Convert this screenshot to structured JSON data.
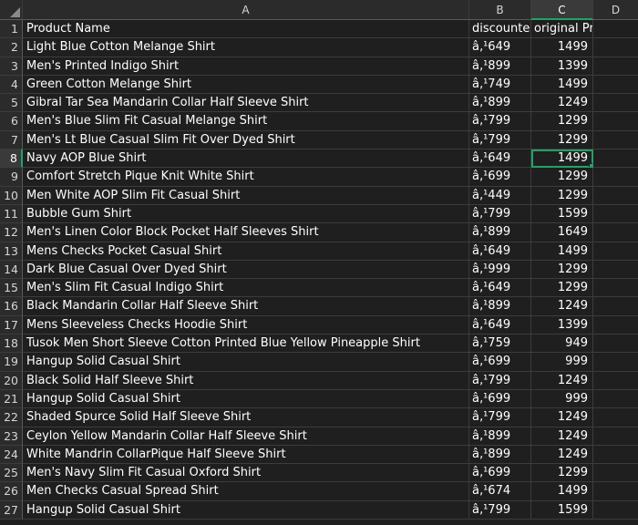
{
  "columns": [
    "A",
    "B",
    "C",
    "D"
  ],
  "header_row": {
    "product": "Product Name",
    "discounted": "discounte",
    "original": "original Price"
  },
  "rows": [
    {
      "n": "2",
      "product": "Light Blue Cotton Melange Shirt",
      "discounted": "â‚¹649",
      "original": "1499"
    },
    {
      "n": "3",
      "product": "Men's Printed Indigo Shirt",
      "discounted": "â‚¹899",
      "original": "1399"
    },
    {
      "n": "4",
      "product": "Green Cotton Melange Shirt",
      "discounted": "â‚¹749",
      "original": "1499"
    },
    {
      "n": "5",
      "product": "Gibral Tar Sea Mandarin Collar Half Sleeve Shirt",
      "discounted": "â‚¹899",
      "original": "1249"
    },
    {
      "n": "6",
      "product": "Men's Blue Slim Fit Casual Melange Shirt",
      "discounted": "â‚¹799",
      "original": "1299"
    },
    {
      "n": "7",
      "product": "Men's Lt Blue Casual Slim Fit Over Dyed Shirt",
      "discounted": "â‚¹799",
      "original": "1299"
    },
    {
      "n": "8",
      "product": "Navy AOP Blue Shirt",
      "discounted": "â‚¹649",
      "original": "1499"
    },
    {
      "n": "9",
      "product": "Comfort Stretch Pique Knit White Shirt",
      "discounted": "â‚¹699",
      "original": "1299"
    },
    {
      "n": "10",
      "product": "Men White AOP Slim Fit Casual Shirt",
      "discounted": "â‚¹449",
      "original": "1299"
    },
    {
      "n": "11",
      "product": "Bubble Gum Shirt",
      "discounted": "â‚¹799",
      "original": "1599"
    },
    {
      "n": "12",
      "product": "Men's Linen Color Block Pocket Half Sleeves Shirt",
      "discounted": "â‚¹899",
      "original": "1649"
    },
    {
      "n": "13",
      "product": "Mens Checks Pocket Casual Shirt",
      "discounted": "â‚¹649",
      "original": "1499"
    },
    {
      "n": "14",
      "product": "Dark Blue Casual Over Dyed Shirt",
      "discounted": "â‚¹999",
      "original": "1299"
    },
    {
      "n": "15",
      "product": "Men's Slim Fit Casual Indigo Shirt",
      "discounted": "â‚¹649",
      "original": "1299"
    },
    {
      "n": "16",
      "product": "Black Mandarin Collar Half Sleeve Shirt",
      "discounted": "â‚¹899",
      "original": "1249"
    },
    {
      "n": "17",
      "product": "Mens Sleeveless Checks Hoodie Shirt",
      "discounted": "â‚¹649",
      "original": "1399"
    },
    {
      "n": "18",
      "product": "Tusok Men Short Sleeve Cotton Printed Blue Yellow Pineapple Shirt",
      "discounted": "â‚¹759",
      "original": "949"
    },
    {
      "n": "19",
      "product": "Hangup Solid Casual Shirt",
      "discounted": "â‚¹699",
      "original": "999"
    },
    {
      "n": "20",
      "product": "Black Solid Half Sleeve Shirt",
      "discounted": "â‚¹799",
      "original": "1249"
    },
    {
      "n": "21",
      "product": "Hangup Solid Casual Shirt",
      "discounted": "â‚¹699",
      "original": "999"
    },
    {
      "n": "22",
      "product": "Shaded Spurce Solid Half Sleeve Shirt",
      "discounted": "â‚¹799",
      "original": "1249"
    },
    {
      "n": "23",
      "product": "Ceylon Yellow Mandarin Collar Half Sleeve Shirt",
      "discounted": "â‚¹899",
      "original": "1249"
    },
    {
      "n": "24",
      "product": "White Mandrin CollarPique Half Sleeve Shirt",
      "discounted": "â‚¹899",
      "original": "1249"
    },
    {
      "n": "25",
      "product": "Men's Navy Slim Fit Casual Oxford Shirt",
      "discounted": "â‚¹699",
      "original": "1299"
    },
    {
      "n": "26",
      "product": "Men Checks Casual Spread Shirt",
      "discounted": "â‚¹674",
      "original": "1499"
    },
    {
      "n": "27",
      "product": "Hangup Solid Casual Shirt",
      "discounted": "â‚¹799",
      "original": "1599"
    }
  ],
  "selection": {
    "column": "C",
    "row": "8"
  },
  "colors": {
    "background": "#1f1f1f",
    "header": "#2b2b2b",
    "gridline": "#3c3c3c",
    "accent": "#21a366",
    "text": "#ffffff"
  }
}
